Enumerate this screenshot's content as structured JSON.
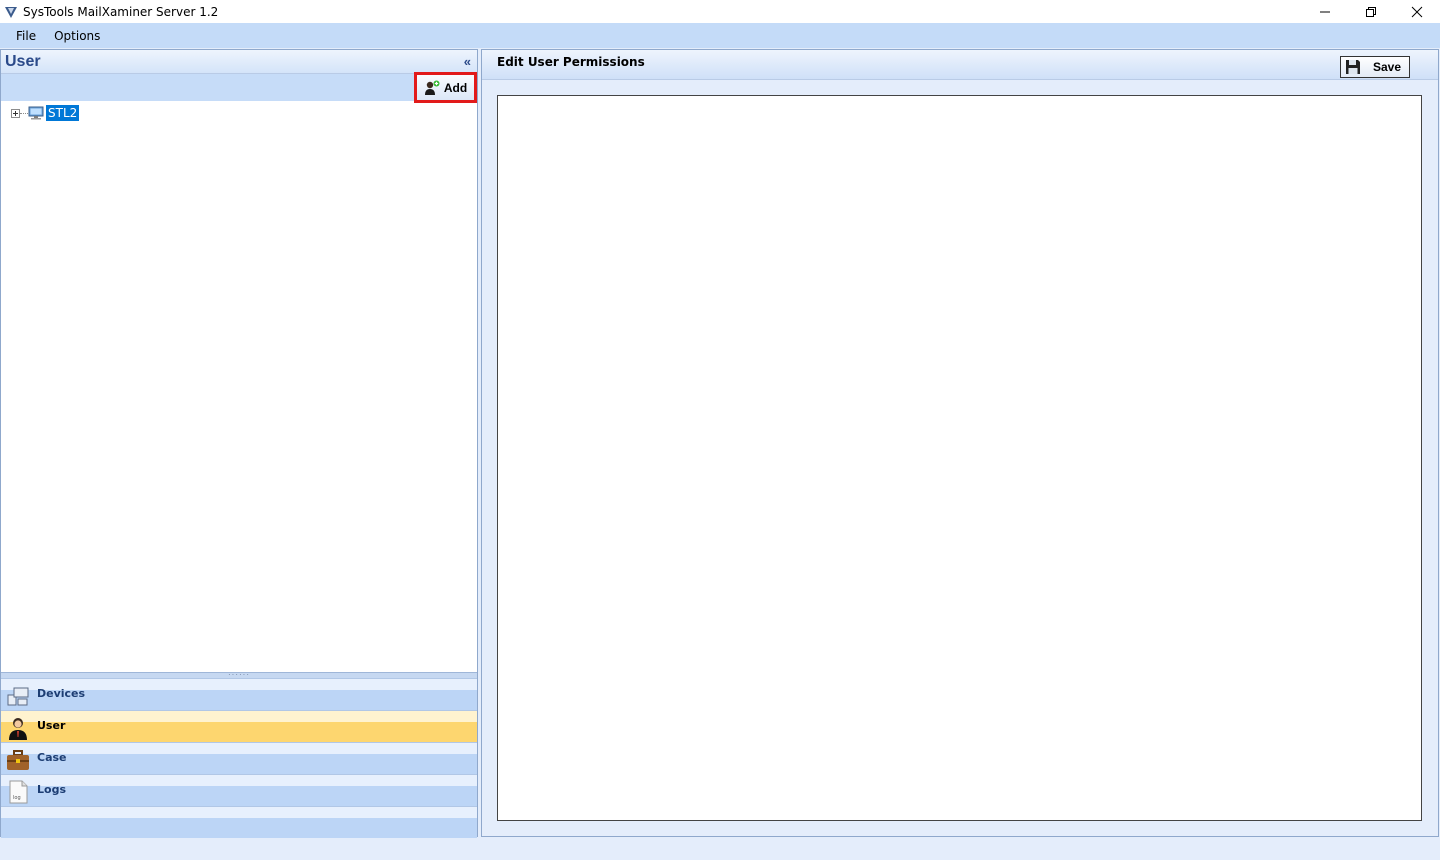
{
  "window": {
    "title": "SysTools MailXaminer Server 1.2"
  },
  "menu": {
    "items": [
      "File",
      "Options"
    ]
  },
  "left_panel": {
    "title": "User",
    "collapse_glyph": "«",
    "add_label": "Add",
    "tree": [
      {
        "label": "STL2",
        "selected": true,
        "expanded": false
      }
    ],
    "nav": [
      {
        "label": "Devices",
        "icon": "devices-icon",
        "active": false
      },
      {
        "label": "User",
        "icon": "user-icon",
        "active": true
      },
      {
        "label": "Case",
        "icon": "briefcase-icon",
        "active": false
      },
      {
        "label": "Logs",
        "icon": "log-file-icon",
        "active": false
      }
    ]
  },
  "right_panel": {
    "title": "Edit User Permissions",
    "save_label": "Save"
  },
  "colors": {
    "accent_header": "#2b4a8a",
    "menu_bg": "#c4dbf8",
    "selection": "#0078d7",
    "active_nav": "#fdd66f",
    "highlight_border": "#e21a1a"
  }
}
